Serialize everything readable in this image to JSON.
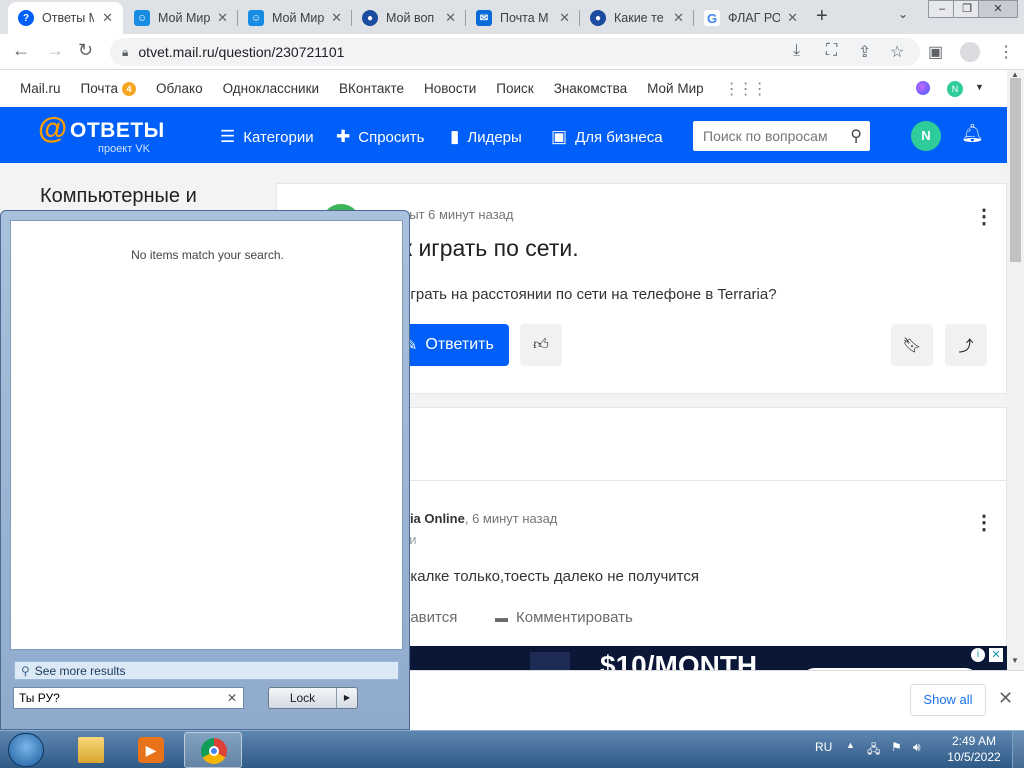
{
  "browser": {
    "tabs": [
      {
        "title": "Ответы M",
        "icon": "otvety-icon",
        "color": "#005ff9"
      },
      {
        "title": "Мой Мир",
        "icon": "moimir-icon",
        "color": "#168de2"
      },
      {
        "title": "Мой Мир",
        "icon": "moimir-icon",
        "color": "#168de2"
      },
      {
        "title": "Мой воп",
        "icon": "otvety-icon",
        "color": "#1b4c9e"
      },
      {
        "title": "Почта M",
        "icon": "mail-icon",
        "color": "#0a6ad8"
      },
      {
        "title": "Какие те",
        "icon": "otvety-icon",
        "color": "#1b4c9e"
      },
      {
        "title": "ФЛАГ РО",
        "icon": "google-icon",
        "color": "#4285f4"
      }
    ],
    "url": "otvet.mail.ru/question/230721101"
  },
  "portal": {
    "links": [
      "Mail.ru",
      "Почта",
      "Облако",
      "Одноклассники",
      "ВКонтакте",
      "Новости",
      "Поиск",
      "Знакомства",
      "Мой Мир"
    ],
    "mail_badge": "4",
    "avatar_letter": "N"
  },
  "header": {
    "logo": "ОТВЕТЫ",
    "logo_sub": "проект VK",
    "nav": [
      "Категории",
      "Спросить",
      "Лидеры",
      "Для бизнеса"
    ],
    "search_placeholder": "Поиск по вопросам",
    "avatar_letter": "N"
  },
  "page": {
    "category": "Компьютерные и",
    "question": {
      "meta": "рыт 6 минут назад",
      "title": "к играть по сети.",
      "body": "играть на расстоянии по сети на телефоне в Terraria?",
      "answer_button": "Ответить"
    },
    "answer": {
      "author": "nia Online",
      "time": ", 6 минут назад",
      "subtitle": "ии",
      "body": "окалке только,тоесть далеко не получится",
      "like_label": "равится",
      "comment_label": "Комментировать"
    },
    "ad_text": "$10/MONTH"
  },
  "downloads": {
    "show_all": "Show all"
  },
  "start_menu": {
    "no_items": "No items match your search.",
    "see_more": "See more results",
    "search_value": "Ты РУ?",
    "lock_label": "Lock"
  },
  "taskbar": {
    "lang": "RU",
    "time": "2:49 AM",
    "date": "10/5/2022"
  }
}
